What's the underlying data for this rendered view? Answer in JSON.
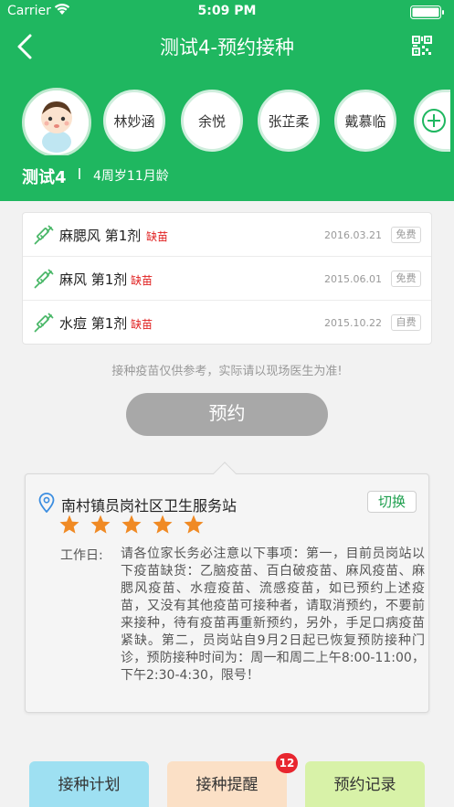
{
  "status_bar": {
    "carrier": "Carrier",
    "time": "5:09 PM"
  },
  "nav": {
    "title": "测试4-预约接种",
    "back_icon": "chevron-left-icon",
    "qr_icon": "qr-code-icon"
  },
  "children": [
    {
      "name": "林妙涵"
    },
    {
      "name": "余悦"
    },
    {
      "name": "张芷柔"
    },
    {
      "name": "戴慕临"
    }
  ],
  "current_child": {
    "name": "测试4",
    "age": "4周岁11月龄"
  },
  "vaccines": [
    {
      "name": "麻腮风 第1剂",
      "status": "缺苗",
      "date": "2016.03.21",
      "fee": "免费"
    },
    {
      "name": "麻风 第1剂",
      "status": "缺苗",
      "date": "2015.06.01",
      "fee": "免费"
    },
    {
      "name": "水痘 第1剂",
      "status": "缺苗",
      "date": "2015.10.22",
      "fee": "自费"
    }
  ],
  "note": "接种疫苗仅供参考，实际请以现场医生为准!",
  "book_button": "预约",
  "station": {
    "name": "南村镇员岗社区卫生服务站",
    "switch_label": "切换",
    "rating": 5,
    "work_label": "工作日:",
    "work_text": "请各位家长务必注意以下事项：第一，目前员岗站以下疫苗缺货：乙脑疫苗、百白破疫苗、麻风疫苗、麻腮风疫苗、水痘疫苗、流感疫苗，如已预约上述疫苗，又没有其他疫苗可接种者，请取消预约，不要前来接种，待有疫苗再重新预约，另外，手足口病疫苗紧缺。第二，员岗站自9月2日起已恢复预防接种门诊，预防接种时间为：周一和周二上午8:00-11:00，下午2:30-4:30，限号！"
  },
  "tabs": {
    "plan": "接种计划",
    "remind": "接种提醒",
    "records": "预约记录",
    "remind_badge": "12"
  },
  "colors": {
    "brand": "#1fb760",
    "shortage": "#e02020",
    "star": "#f08a24",
    "badge": "#e8262f"
  }
}
